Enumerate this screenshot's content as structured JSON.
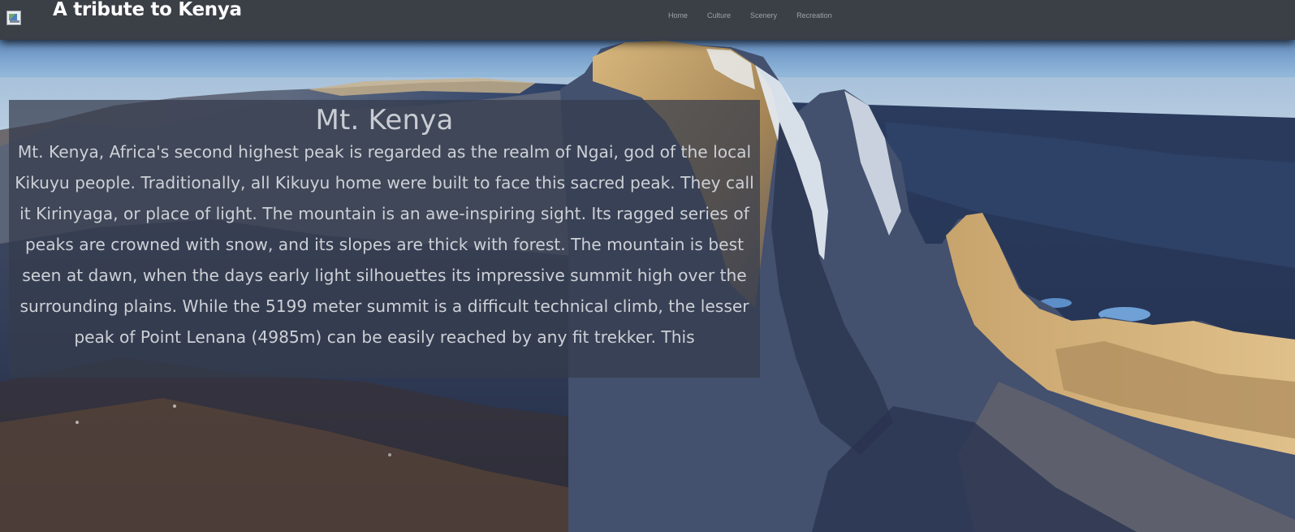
{
  "header": {
    "logo_icon": "broken-image-icon",
    "site_title": "A tribute to Kenya",
    "nav": [
      {
        "label": "Home"
      },
      {
        "label": "Culture"
      },
      {
        "label": "Scenery"
      },
      {
        "label": "Recreation"
      }
    ]
  },
  "panel": {
    "title": "Mt. Kenya",
    "body": "Mt. Kenya, Africa's second highest peak is regarded as the realm of Ngai, god of the local Kikuyu people. Traditionally, all Kikuyu home were built to face this sacred peak. They call it Kirinyaga, or place of light. The mountain is an awe-inspiring sight. Its ragged series of peaks are crowned with snow, and its slopes are thick with forest. The mountain is best seen at dawn, when the days early light silhouettes its impressive summit high over the surrounding plains. While the 5199 meter summit is a difficult technical climb, the lesser peak of Point Lenana (4985m) can be easily reached by any fit trekker. This"
  },
  "colors": {
    "navbar": "#3b3f46",
    "panel": "rgba(52,60,76,0.72)",
    "text": "#cdd0d6"
  }
}
